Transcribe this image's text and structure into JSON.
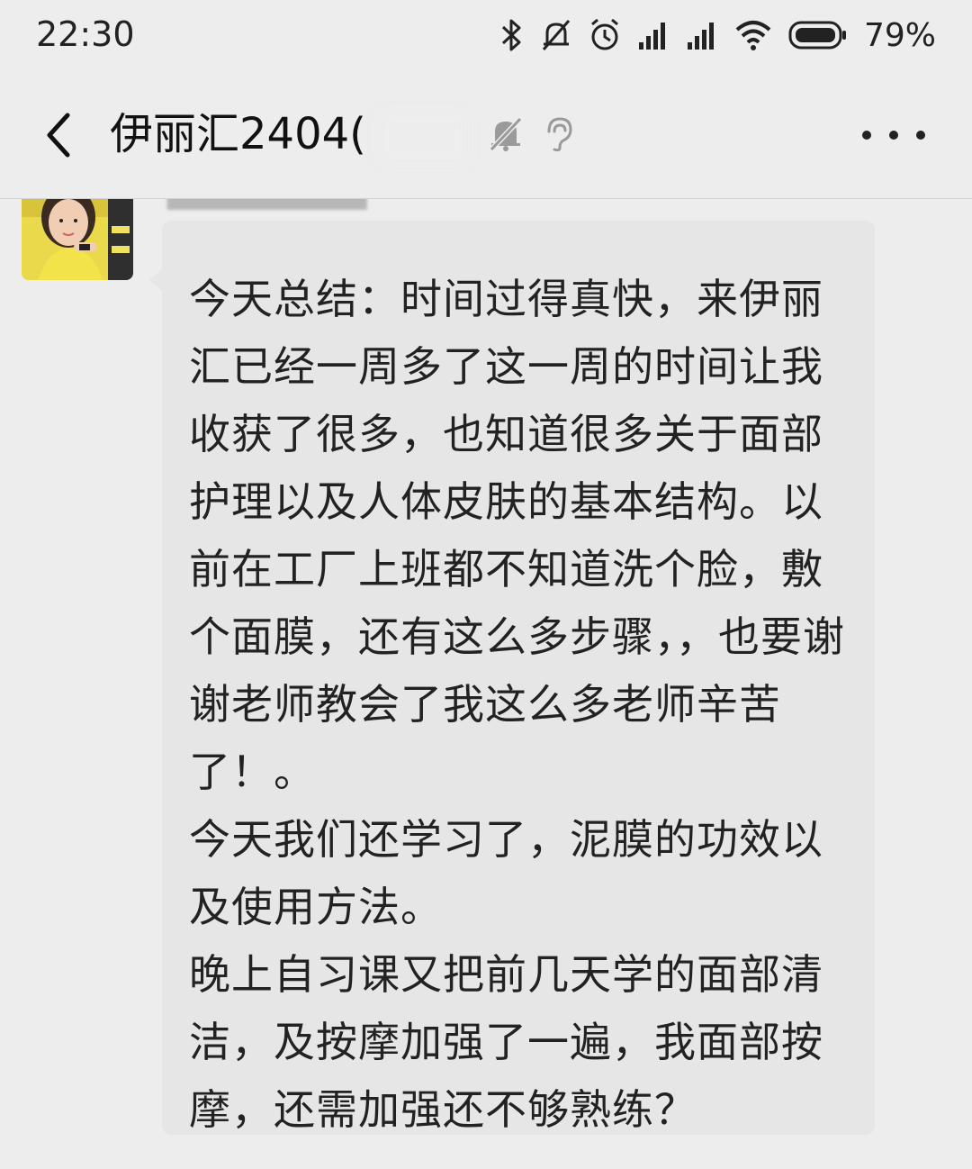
{
  "status_bar": {
    "time": "22:30",
    "battery": "79%",
    "icons": [
      "bluetooth-icon",
      "mute-notification-icon",
      "alarm-icon",
      "signal-icon",
      "signal-icon",
      "wifi-icon",
      "battery-icon"
    ]
  },
  "nav": {
    "title": "伊丽汇2404(",
    "icons": [
      "back-arrow-icon",
      "mute-bell-icon",
      "ear-icon",
      "more-icon"
    ]
  },
  "chat": {
    "message_text": "今天总结：时间过得真快，来伊丽汇已经一周多了这一周的时间让我收获了很多，也知道很多关于面部护理以及人体皮肤的基本结构。以前在工厂上班都不知道洗个脸，敷个面膜，还有这么多步骤，，也要谢谢老师教会了我这么多老师辛苦了！。\n今天我们还学习了，泥膜的功效以及使用方法。\n晚上自习课又把前几天学的面部清洁，及按摩加强了一遍，我面部按摩，还需加强还不够熟练？"
  },
  "colors": {
    "background": "#ededed",
    "bubble": "#e6e6e6",
    "text": "#222222"
  }
}
